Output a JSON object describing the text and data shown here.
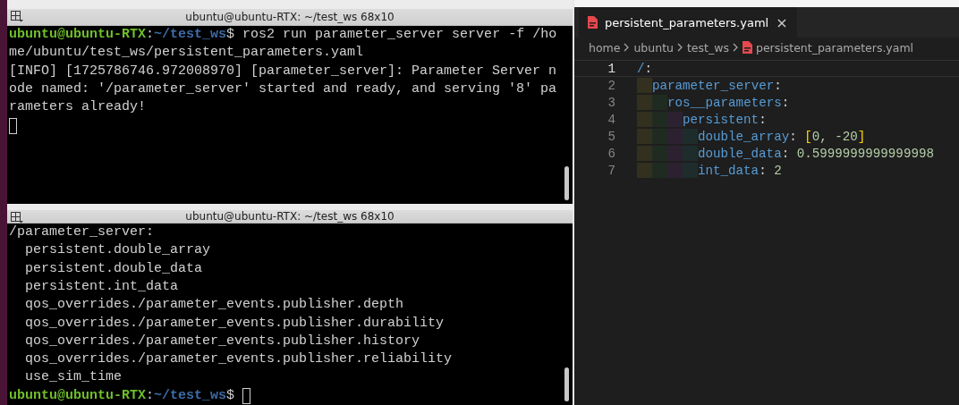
{
  "terminals": [
    {
      "title": "ubuntu@ubuntu-RTX: ~/test_ws 68x10",
      "lines": [
        {
          "kind": "prompt",
          "user": "ubuntu@ubuntu-RTX",
          "separator": ":",
          "path": "~/test_ws",
          "symbol": "$",
          "command": "ros2 run parameter_server server -f /ho"
        },
        {
          "kind": "output",
          "text": "me/ubuntu/test_ws/persistent_parameters.yaml"
        },
        {
          "kind": "output",
          "text": "[INFO] [1725786746.972008970] [parameter_server]: Parameter Server n"
        },
        {
          "kind": "output",
          "text": "ode named: '/parameter_server' started and ready, and serving '8' pa"
        },
        {
          "kind": "output",
          "text": "rameters already!"
        },
        {
          "kind": "cursor"
        }
      ]
    },
    {
      "title": "ubuntu@ubuntu-RTX: ~/test_ws 68x10",
      "lines": [
        {
          "kind": "output",
          "text": "/parameter_server:"
        },
        {
          "kind": "output",
          "text": "  persistent.double_array"
        },
        {
          "kind": "output",
          "text": "  persistent.double_data"
        },
        {
          "kind": "output",
          "text": "  persistent.int_data"
        },
        {
          "kind": "output",
          "text": "  qos_overrides./parameter_events.publisher.depth"
        },
        {
          "kind": "output",
          "text": "  qos_overrides./parameter_events.publisher.durability"
        },
        {
          "kind": "output",
          "text": "  qos_overrides./parameter_events.publisher.history"
        },
        {
          "kind": "output",
          "text": "  qos_overrides./parameter_events.publisher.reliability"
        },
        {
          "kind": "output",
          "text": "  use_sim_time"
        },
        {
          "kind": "prompt",
          "user": "ubuntu@ubuntu-RTX",
          "separator": ":",
          "path": "~/test_ws",
          "symbol": "$",
          "cursor": true
        }
      ]
    }
  ],
  "editor": {
    "tab": {
      "label": "persistent_parameters.yaml",
      "close": "×",
      "selected": true
    },
    "breadcrumb": [
      "home",
      "ubuntu",
      "test_ws",
      "persistent_parameters.yaml"
    ],
    "lines": [
      {
        "number": "1",
        "key": "/",
        "colon": ":",
        "current": true,
        "children": [
          {
            "number": "2",
            "key": "parameter_server",
            "colon": ":",
            "current": false,
            "children": [
              {
                "number": "3",
                "key": "ros__parameters",
                "colon": ":",
                "current": false,
                "children": [
                  {
                    "number": "4",
                    "key": "persistent",
                    "colon": ":",
                    "current": false,
                    "children": [
                      {
                        "number": "5",
                        "key": "double_array",
                        "colon": ":",
                        "current": false,
                        "value": {
                          "kind": "array",
                          "open": "[",
                          "items": "0, -20",
                          "close": "]"
                        }
                      },
                      {
                        "number": "6",
                        "key": "double_data",
                        "colon": ":",
                        "current": false,
                        "value": {
                          "kind": "number",
                          "text": "0.5999999999999998"
                        }
                      },
                      {
                        "number": "7",
                        "key": "int_data",
                        "colon": ":",
                        "current": false,
                        "value": {
                          "kind": "number",
                          "text": "2"
                        }
                      }
                    ]
                  }
                ]
              }
            ]
          }
        ]
      }
    ]
  }
}
